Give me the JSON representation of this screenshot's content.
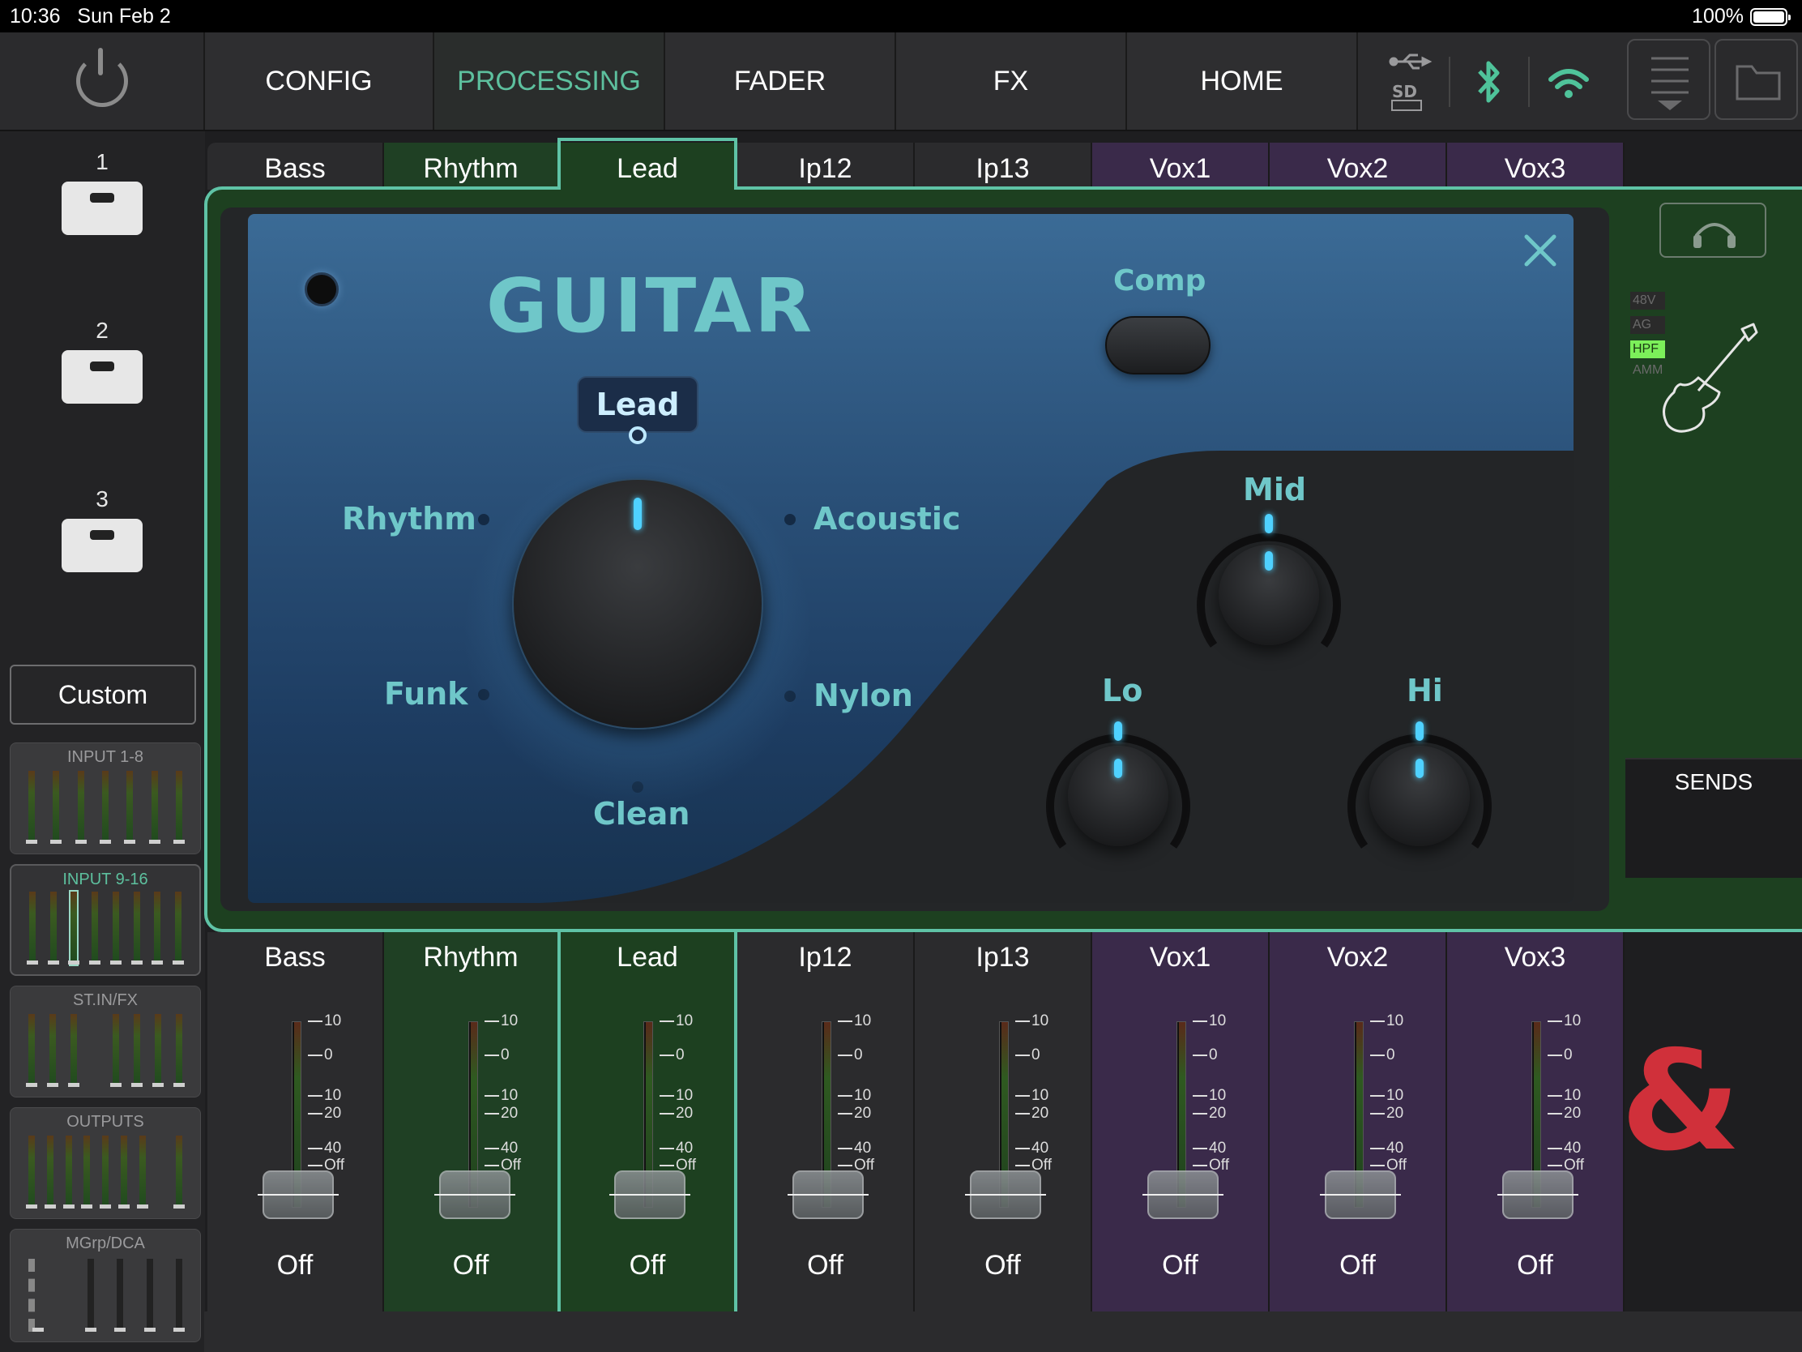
{
  "status": {
    "time": "10:36",
    "date": "Sun Feb 2",
    "battery": "100%"
  },
  "nav": {
    "tabs": [
      {
        "label": "CONFIG"
      },
      {
        "label": "PROCESSING"
      },
      {
        "label": "FADER"
      },
      {
        "label": "FX"
      },
      {
        "label": "HOME"
      }
    ]
  },
  "sidebar": {
    "scenes": [
      {
        "label": "1"
      },
      {
        "label": "2"
      },
      {
        "label": "3"
      }
    ],
    "custom_label": "Custom",
    "groups": [
      {
        "label": "INPUT 1-8"
      },
      {
        "label": "INPUT 9-16"
      },
      {
        "label": "ST.IN/FX"
      },
      {
        "label": "OUTPUTS"
      },
      {
        "label": "MGrp/DCA"
      }
    ]
  },
  "channels": [
    {
      "name": "Bass",
      "fader": "Off"
    },
    {
      "name": "Rhythm",
      "fader": "Off"
    },
    {
      "name": "Lead",
      "fader": "Off"
    },
    {
      "name": "Ip12",
      "fader": "Off"
    },
    {
      "name": "Ip13",
      "fader": "Off"
    },
    {
      "name": "Vox1",
      "fader": "Off"
    },
    {
      "name": "Vox2",
      "fader": "Off"
    },
    {
      "name": "Vox3",
      "fader": "Off"
    }
  ],
  "fader_scale": [
    "10",
    "0",
    "10",
    "20",
    "40",
    "Off"
  ],
  "plugin": {
    "title": "GUITAR",
    "selected_preset": "Lead",
    "presets": {
      "rhythm": "Rhythm",
      "acoustic": "Acoustic",
      "funk": "Funk",
      "nylon": "Nylon",
      "clean": "Clean"
    },
    "comp_label": "Comp",
    "eq": {
      "mid": "Mid",
      "lo": "Lo",
      "hi": "Hi"
    }
  },
  "channel_flags": [
    "48V",
    "AG",
    "HPF",
    "AMM"
  ],
  "sends_label": "SENDS",
  "logo_glyph": "&",
  "colors": {
    "accent": "#5fc3a6",
    "plugin_text": "#6fc7c9",
    "knob_indicator": "#4fd1ff",
    "hpf_on": "#7cf05a",
    "logo": "#d0303a"
  }
}
